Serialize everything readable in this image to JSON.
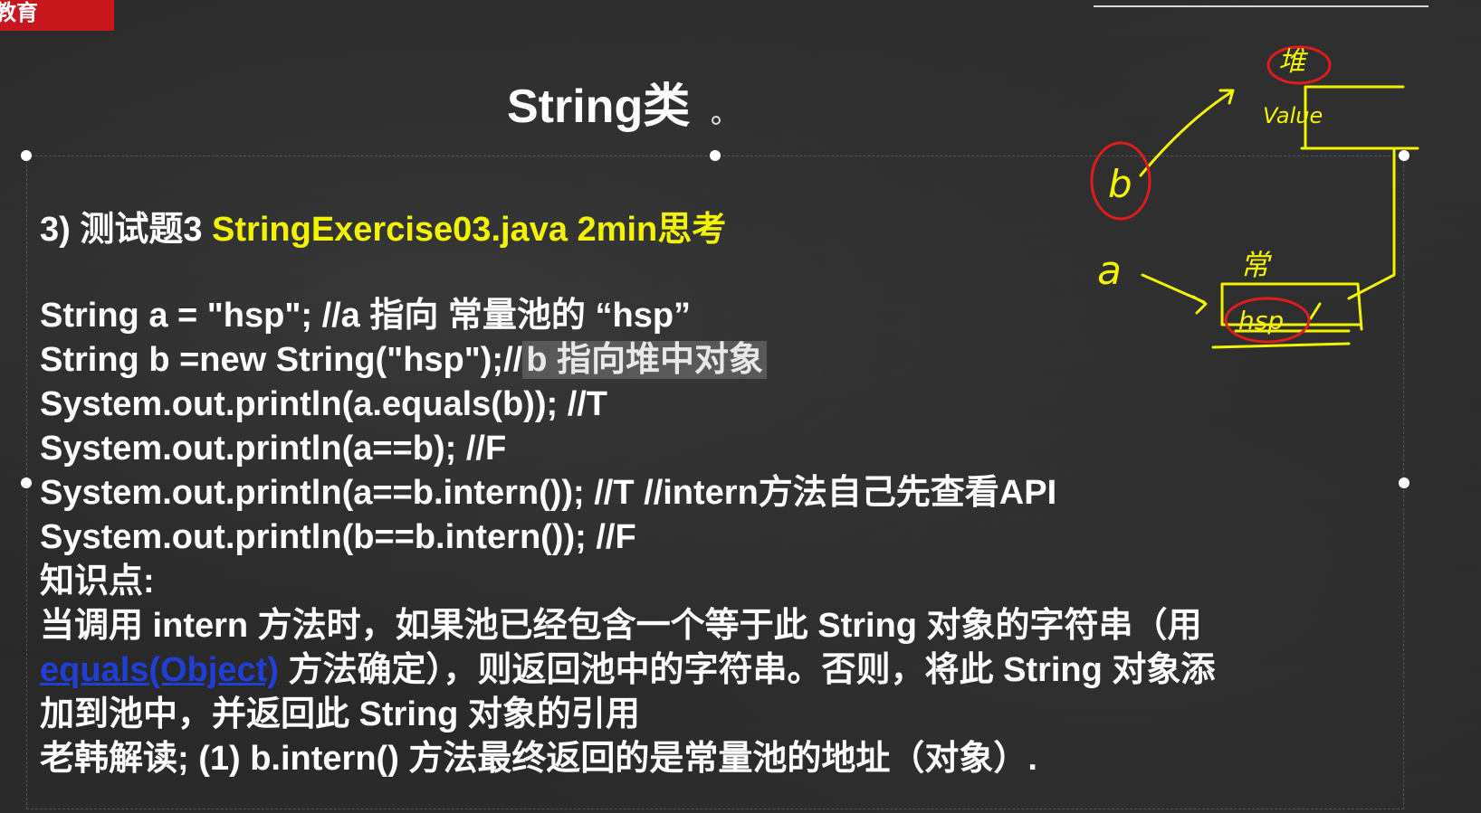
{
  "logo": {
    "text": "教育"
  },
  "slide": {
    "title": "String类",
    "heading_prefix": "3) 测试题3 ",
    "heading_highlight": "StringExercise03.java 2min思考",
    "code": {
      "line1": "String a = \"hsp\"; //a 指向 常量池的 “hsp”",
      "line2_main": "String b =new String(\"hsp\");//",
      "line2_highlight": "b 指向堆中对象",
      "line3": "System.out.println(a.equals(b)); //T",
      "line4": "System.out.println(a==b); //F",
      "line5": "System.out.println(a==b.intern()); //T //intern方法自己先查看API",
      "line6": "System.out.println(b==b.intern()); //F"
    },
    "knowledge": {
      "label": "知识点:",
      "p1": "当调用 intern 方法时，如果池已经包含一个等于此 String 对象的字符串（用",
      "p2_link": "equals(Object)",
      "p2_rest": " 方法确定），则返回池中的字符串。否则，将此 String 对象添",
      "p3": "加到池中，并返回此 String 对象的引用",
      "p4": "老韩解读; (1) b.intern() 方法最终返回的是常量池的地址（对象）."
    }
  },
  "annotation": {
    "heap_label": "堆",
    "value_label": "Value",
    "var_b": "b",
    "var_a": "a",
    "pool_label": "常",
    "pool_value": "hsp"
  },
  "colors": {
    "yellow": "#f3f300",
    "red": "#e01c1c",
    "link": "#1f3fd6",
    "logo_red": "#c8161d"
  }
}
